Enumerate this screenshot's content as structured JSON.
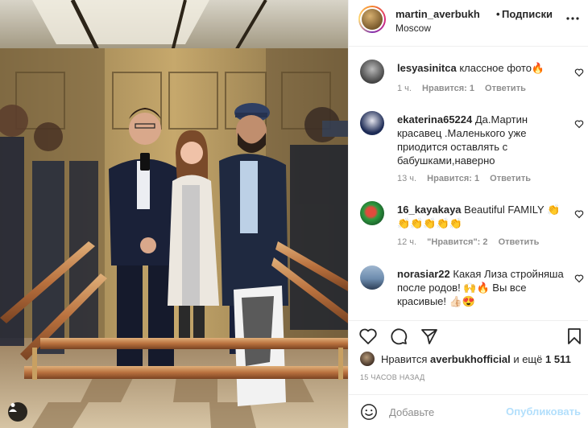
{
  "post": {
    "username": "martin_averbukh",
    "separator": "•",
    "follow_label": "Подписки",
    "location": "Moscow",
    "more_icon": "more-horizontal-icon"
  },
  "comments": [
    {
      "username": "lesyasinitca",
      "text": "классное фото🔥",
      "time": "1 ч.",
      "likes": "Нравится: 1",
      "reply": "Ответить",
      "avatar_color": "#6e6e6e"
    },
    {
      "username": "ekaterina65224",
      "text": "Да.Мартин красавец .Маленького уже приодится оставлять с бабушками,наверно",
      "time": "13 ч.",
      "likes": "Нравится: 1",
      "reply": "Ответить",
      "avatar_color": "#2b3a63"
    },
    {
      "username": "16_kayakaya",
      "text": "Beautiful FAMILY 👏 👏👏👏👏👏",
      "time": "12 ч.",
      "likes": "\"Нравится\": 2",
      "reply": "Ответить",
      "avatar_color": "#2f8f3c"
    },
    {
      "username": "norasiar22",
      "text": "Какая Лиза стройняша после родов! 🙌🔥 Вы все красивые! 👍🏻😍",
      "time": "",
      "likes": "",
      "reply": "",
      "avatar_color": "#4b6f99"
    }
  ],
  "likes": {
    "prefix": "Нравится",
    "user": "averbukhofficial",
    "suffix": "и ещё",
    "count": "1 511"
  },
  "timestamp": "15 ЧАСОВ НАЗАД",
  "add_comment": {
    "placeholder": "Добавьте",
    "post_label": "Опубликовать",
    "post_color": "#b2dffc"
  }
}
